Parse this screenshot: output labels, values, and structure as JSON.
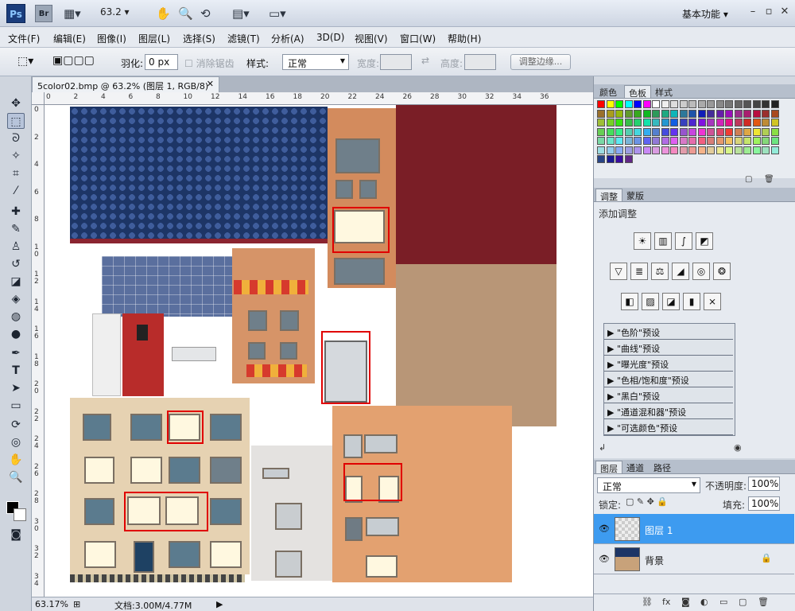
{
  "appbar": {
    "logo": "Ps",
    "bridge": "Br",
    "zoom": "63.2",
    "workspace": "基本功能",
    "icons": [
      "frame-icon",
      "hand-icon",
      "zoom-icon",
      "rotate-icon",
      "arrange-icon",
      "screenmode-icon"
    ]
  },
  "menu": [
    "文件(F)",
    "编辑(E)",
    "图像(I)",
    "图层(L)",
    "选择(S)",
    "滤镜(T)",
    "分析(A)",
    "3D(D)",
    "视图(V)",
    "窗口(W)",
    "帮助(H)"
  ],
  "options": {
    "feather_label": "羽化:",
    "feather_value": "0 px",
    "antialias_label": "消除锯齿",
    "style_label": "样式:",
    "style_value": "正常",
    "width_label": "宽度:",
    "height_label": "高度:",
    "refine_edge": "调整边缘..."
  },
  "document": {
    "tab_title": "5color02.bmp @ 63.2% (图层 1, RGB/8) *",
    "ruler_h": [
      "0",
      "2",
      "4",
      "6",
      "8",
      "10",
      "12",
      "14",
      "16",
      "18",
      "20",
      "22",
      "24",
      "26",
      "28",
      "30",
      "32",
      "34",
      "36"
    ],
    "ruler_v": [
      "0",
      "2",
      "4",
      "6",
      "8",
      "1\n0",
      "1\n2",
      "1\n4",
      "1\n6",
      "1\n8",
      "2\n0",
      "2\n2",
      "2\n4",
      "2\n6",
      "2\n8",
      "3\n0",
      "3\n2",
      "3\n4"
    ],
    "status_zoom": "63.17%",
    "status_doc": "文档:3.00M/4.77M"
  },
  "panels": {
    "swatches_tabs": [
      "颜色",
      "色板",
      "样式"
    ],
    "swatches_active": "色板",
    "adjust_tabs": [
      "调整",
      "蒙版"
    ],
    "adjust_title": "添加调整",
    "presets": [
      "\"色阶\"预设",
      "\"曲线\"预设",
      "\"曝光度\"预设",
      "\"色相/饱和度\"预设",
      "\"黑白\"预设",
      "\"通道混和器\"预设",
      "\"可选颜色\"预设"
    ],
    "layer_tabs": [
      "图层",
      "通道",
      "路径"
    ],
    "blend_mode": "正常",
    "opacity_label": "不透明度:",
    "opacity_value": "100%",
    "lock_label": "锁定:",
    "fill_label": "填充:",
    "fill_value": "100%",
    "layers": [
      {
        "name": "图层 1",
        "selected": true
      },
      {
        "name": "背景",
        "selected": false
      }
    ]
  },
  "colors": {
    "accent": "#3d9bf0",
    "brand": "#1a3d7c",
    "highlight_box": "#e00000"
  }
}
